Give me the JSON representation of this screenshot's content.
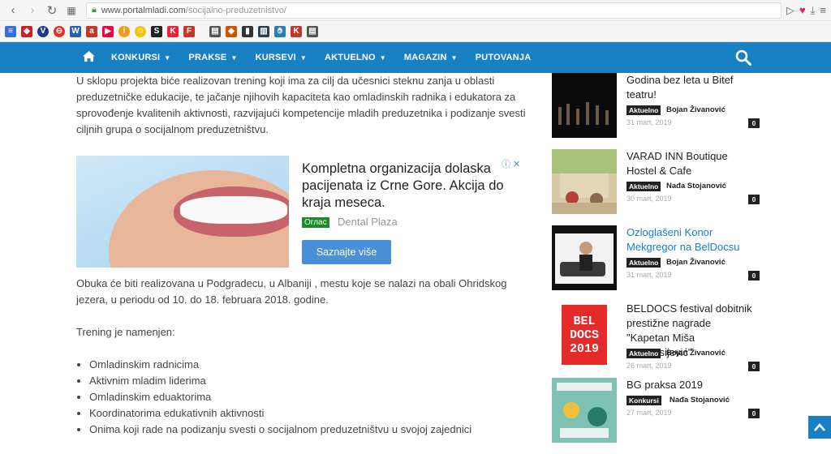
{
  "browser": {
    "url_host": "www.portalmladi.com",
    "url_path": "/socijalno-preduzetnistvo/"
  },
  "nav": {
    "items": [
      {
        "label": "KONKURSI",
        "caret": true
      },
      {
        "label": "PRAKSE",
        "caret": true
      },
      {
        "label": "KURSEVI",
        "caret": true
      },
      {
        "label": "AKTUELNO",
        "caret": true
      },
      {
        "label": "MAGAZIN",
        "caret": true
      },
      {
        "label": "PUTOVANJA",
        "caret": false
      }
    ]
  },
  "article": {
    "para1": "U sklopu projekta biće realizovan trening koji ima za cilj da učesnici steknu zanja u oblasti preduzetničke edukacije, te jačanje njihovih kapaciteta kao omladinskih radnika i edukatora za sprovođenje kvalitenih aktivnosti, razvijajući kompetencije mladih preduzetnika i podizanje svesti ciljnih grupa o socijalnom preduzetništvu.",
    "para2": "Obuka će biti realizovana u Podgradecu, u Albaniji , mestu koje se nalazi na obali Ohridskog jezera, u periodu od 10. do 18. februara 2018. godine.",
    "para3": "Trening je namenjen:",
    "bullets": [
      "Omladinskim radnicima",
      "Aktivnim mladim liderima",
      "Omladinskim eduaktorima",
      "Koordinatorima edukativnih aktivnosti",
      "Onima koji rade na podizanju svesti o socijalnom preduzetništvu u svojoj zajednici"
    ]
  },
  "ad": {
    "title": "Kompletna organizacija dolaska pacijenata iz Crne Gore. Akcija do kraja meseca.",
    "badge": "Oглас",
    "brand": "Dental Plaza",
    "button": "Saznajte više"
  },
  "sidebar": {
    "posts": [
      {
        "title": "Godina bez leta u Bitef teatru!",
        "tag": "Aktuelno",
        "author": "Bojan Živanović",
        "date": "31 mart, 2019",
        "comments": "0",
        "highlight": false
      },
      {
        "title": "VARAD INN Boutique Hostel & Cafe",
        "tag": "Aktuelno",
        "author": "Nađa Stojanović",
        "date": "30 mart, 2019",
        "comments": "0",
        "highlight": false
      },
      {
        "title": "Ozloglašeni Konor Mekgregor na BelDocsu",
        "tag": "Aktuelno",
        "author": "Bojan Živanović",
        "date": "31 mart, 2019",
        "comments": "0",
        "highlight": true
      },
      {
        "title": "BELDOCS festival dobitnik prestižne nagrade \"Kapetan Miša Anastasijević\"",
        "tag": "Aktuelno",
        "author": "Bojan Živanović",
        "date": "26 mart, 2019",
        "comments": "0",
        "highlight": false
      },
      {
        "title": "BG praksa 2019",
        "tag": "Konkursi",
        "author": "Nađa Stojanović",
        "date": "27 mart, 2019",
        "comments": "0",
        "highlight": false
      }
    ],
    "beldocs_thumb_text": [
      "BEL",
      "DOCS",
      "2019"
    ]
  },
  "colors": {
    "brand": "#1a80c4",
    "ad_button": "#4a90d9"
  }
}
